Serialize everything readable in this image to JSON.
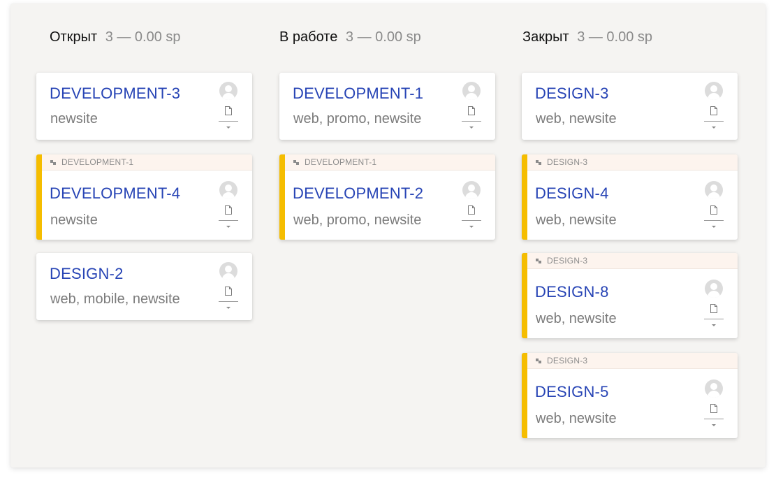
{
  "columns": [
    {
      "title": "Открыт",
      "meta": "3 — 0.00 sp",
      "cards": [
        {
          "key": "DEVELOPMENT-3",
          "tags": "newsite",
          "parent": null
        },
        {
          "key": "DEVELOPMENT-4",
          "tags": "newsite",
          "parent": "DEVELOPMENT-1"
        },
        {
          "key": "DESIGN-2",
          "tags": "web, mobile, newsite",
          "parent": null
        }
      ]
    },
    {
      "title": "В работе",
      "meta": "3 — 0.00 sp",
      "cards": [
        {
          "key": "DEVELOPMENT-1",
          "tags": "web, promo, newsite",
          "parent": null
        },
        {
          "key": "DEVELOPMENT-2",
          "tags": "web, promo, newsite",
          "parent": "DEVELOPMENT-1"
        }
      ]
    },
    {
      "title": "Закрыт",
      "meta": "3 — 0.00 sp",
      "cards": [
        {
          "key": "DESIGN-3",
          "tags": "web, newsite",
          "parent": null
        },
        {
          "key": "DESIGN-4",
          "tags": "web, newsite",
          "parent": "DESIGN-3"
        },
        {
          "key": "DESIGN-8",
          "tags": "web, newsite",
          "parent": "DESIGN-3"
        },
        {
          "key": "DESIGN-5",
          "tags": "web, newsite",
          "parent": "DESIGN-3"
        }
      ]
    }
  ],
  "icons": {
    "avatar": "user-avatar-icon",
    "attachment": "document-icon",
    "menu": "chevron-down-icon",
    "parent": "parent-link-icon"
  },
  "colors": {
    "link": "#2744b5",
    "subtask_accent": "#f5bd00",
    "parent_bar_bg": "#fdf4ee",
    "board_bg": "#f5f4f2"
  }
}
